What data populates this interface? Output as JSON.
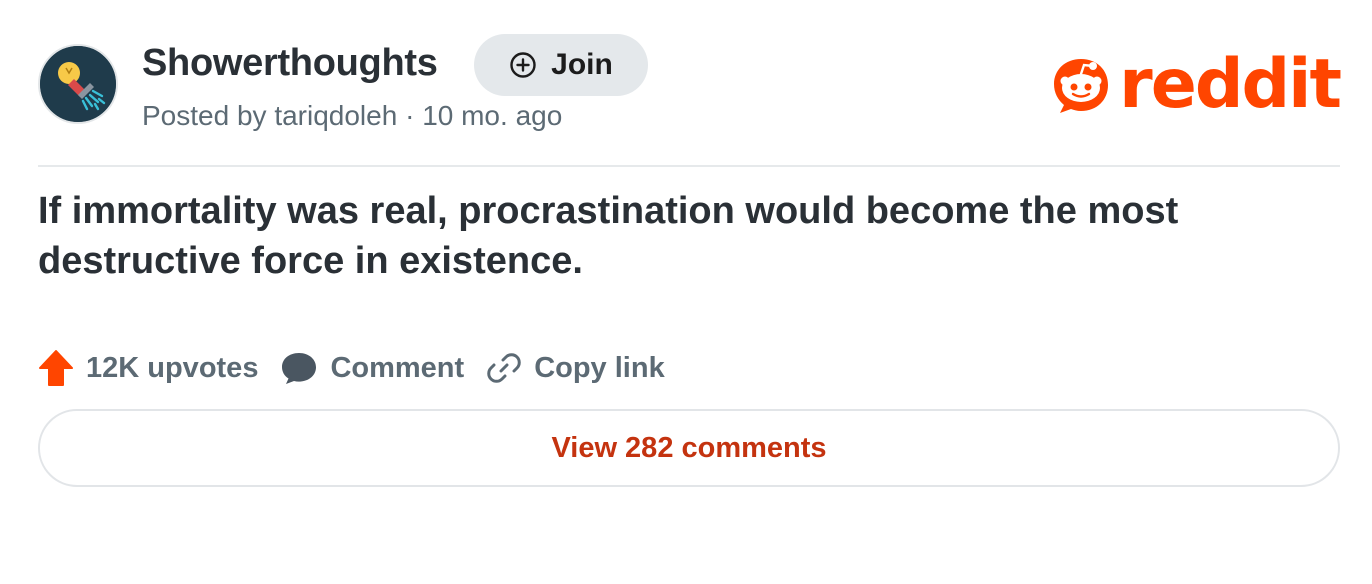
{
  "post_header": {
    "subreddit_name": "Showerthoughts",
    "join_label": "Join",
    "posted_by_prefix": "Posted by",
    "author": "tariqdoleh",
    "separator": "·",
    "time_ago": "10 mo. ago",
    "avatar_icon": "lightbulb-shower-icon",
    "join_icon": "plus-circle-icon"
  },
  "brand": {
    "logo_text": "reddit",
    "logo_icon": "snoo-icon",
    "accent_color": "#ff4500"
  },
  "post": {
    "title": "If immortality was real, procrastination would become the most destructive force in existence."
  },
  "actions": {
    "upvotes_label": "12K upvotes",
    "comment_label": "Comment",
    "copy_link_label": "Copy link",
    "upvote_icon": "upvote-arrow-icon",
    "comment_icon": "speech-bubble-icon",
    "link_icon": "chain-link-icon",
    "upvote_color": "#ff4500"
  },
  "footer": {
    "view_comments_label": "View 282 comments",
    "view_comments_color": "#c4330f"
  }
}
